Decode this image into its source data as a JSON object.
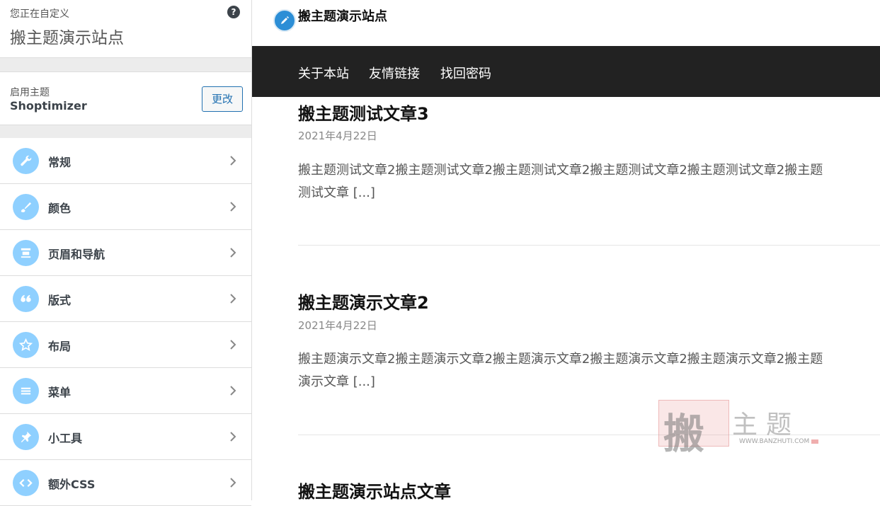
{
  "sidebar": {
    "subtitle": "您正在自定义",
    "title": "搬主题演示站点",
    "help_glyph": "?",
    "theme": {
      "label": "启用主题",
      "name": "Shoptimizer",
      "change_label": "更改"
    },
    "panels": [
      {
        "label": "常规",
        "icon": "wrench-icon"
      },
      {
        "label": "颜色",
        "icon": "brush-icon"
      },
      {
        "label": "页眉和导航",
        "icon": "header-icon"
      },
      {
        "label": "版式",
        "icon": "quote-icon"
      },
      {
        "label": "布局",
        "icon": "star-icon"
      },
      {
        "label": "菜单",
        "icon": "menu-icon"
      },
      {
        "label": "小工具",
        "icon": "pin-icon"
      },
      {
        "label": "额外CSS",
        "icon": "code-icon"
      }
    ],
    "accent_color": "#8fd0ff"
  },
  "preview": {
    "site_name": "搬主题演示站点",
    "nav": [
      "关于本站",
      "友情链接",
      "找回密码"
    ],
    "posts": [
      {
        "title": "搬主题测试文章3",
        "date": "2021年4月22日",
        "excerpt_line1": "搬主题测试文章2搬主题测试文章2搬主题测试文章2搬主题测试文章2搬主题测试文章2搬主题",
        "excerpt_line2": "测试文章 [...]"
      },
      {
        "title": "搬主题演示文章2",
        "date": "2021年4月22日",
        "excerpt_line1": "搬主题演示文章2搬主题演示文章2搬主题演示文章2搬主题演示文章2搬主题演示文章2搬主题",
        "excerpt_line2": "演示文章 [...]"
      },
      {
        "title": "搬主题演示站点文章"
      }
    ],
    "nav_bg_color": "#222222"
  },
  "watermark": {
    "char": "搬",
    "text": "主题",
    "url": "WWW.BANZHUTI.COM"
  }
}
